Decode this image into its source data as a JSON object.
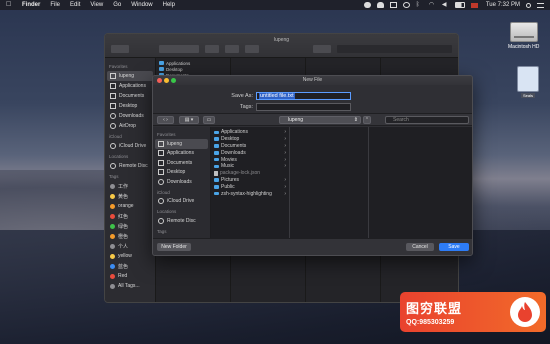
{
  "menubar": {
    "items": [
      "Finder",
      "File",
      "Edit",
      "View",
      "Go",
      "Window",
      "Help"
    ],
    "clock": "Tue 7:32 PM"
  },
  "desktop": {
    "hd_label": "Macintosh HD",
    "file_label": "Seals"
  },
  "finder": {
    "title": "lupeng",
    "sidebar": {
      "favorites_label": "Favorites",
      "favorites": [
        "lupeng",
        "Applications",
        "Documents",
        "Desktop",
        "Downloads",
        "AirDrop"
      ],
      "icloud_label": "iCloud",
      "icloud": [
        "iCloud Drive"
      ],
      "locations_label": "Locations",
      "locations": [
        "Remote Disc"
      ],
      "tags_label": "Tags",
      "tags": [
        {
          "label": "工作",
          "color": "#8e8e93"
        },
        {
          "label": "黄色",
          "color": "#f7c948"
        },
        {
          "label": "orange",
          "color": "#f39a2b"
        },
        {
          "label": "红色",
          "color": "#e94c3d"
        },
        {
          "label": "绿色",
          "color": "#3ec14a"
        },
        {
          "label": "橙色",
          "color": "#f39a2b"
        },
        {
          "label": "个人",
          "color": "#8e8e93"
        },
        {
          "label": "yellow",
          "color": "#f7c948"
        },
        {
          "label": "蓝色",
          "color": "#3b8cf2"
        },
        {
          "label": "Red",
          "color": "#e94c3d"
        },
        {
          "label": "All Tags...",
          "color": "#8e8e93"
        }
      ]
    },
    "col1": [
      "Applications",
      "Desktop",
      "Documents"
    ]
  },
  "dialog": {
    "title": "New File",
    "save_as_label": "Save As:",
    "save_as_value": "untitled file.txt",
    "tags_label": "Tags:",
    "location": "lupeng",
    "search_placeholder": "Search",
    "sidebar": {
      "favorites_label": "Favorites",
      "favorites": [
        "lupeng",
        "Applications",
        "Documents",
        "Desktop",
        "Downloads"
      ],
      "icloud_label": "iCloud",
      "icloud": [
        "iCloud Drive"
      ],
      "locations_label": "Locations",
      "locations": [
        "Remote Disc"
      ],
      "tags_label": "Tags"
    },
    "files": [
      {
        "name": "Applications",
        "kind": "folder"
      },
      {
        "name": "Desktop",
        "kind": "folder"
      },
      {
        "name": "Documents",
        "kind": "folder"
      },
      {
        "name": "Downloads",
        "kind": "folder"
      },
      {
        "name": "Movies",
        "kind": "folder"
      },
      {
        "name": "Music",
        "kind": "folder"
      },
      {
        "name": "package-lock.json",
        "kind": "file"
      },
      {
        "name": "Pictures",
        "kind": "folder"
      },
      {
        "name": "Public",
        "kind": "folder"
      },
      {
        "name": "zsh-syntax-highlighting",
        "kind": "folder"
      }
    ],
    "new_folder": "New Folder",
    "cancel": "Cancel",
    "save": "Save"
  },
  "watermark": {
    "title": "图穷联盟",
    "contact": "QQ:985303259"
  }
}
